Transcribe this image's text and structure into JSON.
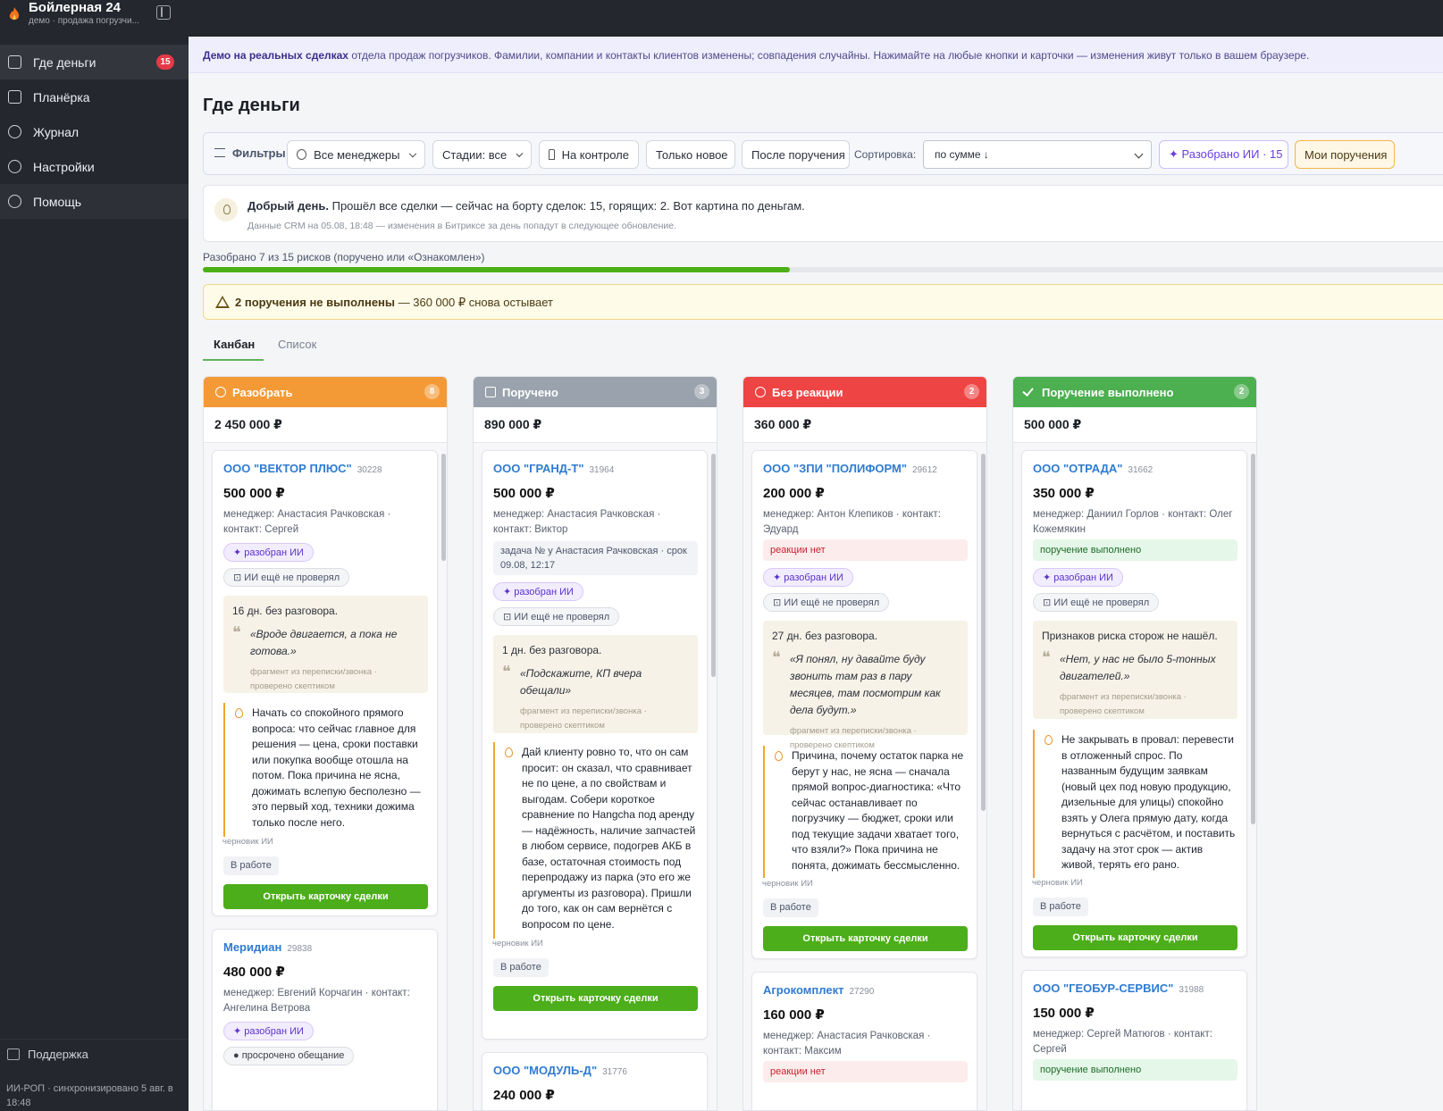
{
  "app": {
    "title": "Бойлерная 24",
    "subtitle": "демо · продажа погрузчи...",
    "sync_text": "ИИ-РОП · синхронизировано 5 авг. в 18:48"
  },
  "sidebar": {
    "items": [
      {
        "label": "Где деньги",
        "icon": "wallet-icon",
        "badge": "15"
      },
      {
        "label": "Планёрка",
        "icon": "clipboard-icon"
      },
      {
        "label": "Журнал",
        "icon": "history-icon"
      },
      {
        "label": "Настройки",
        "icon": "gear-icon"
      },
      {
        "label": "Помощь",
        "icon": "help-icon"
      }
    ],
    "support_label": "Поддержка"
  },
  "banner": {
    "bold": "Демо на реальных сделках",
    "text": " отдела продаж погрузчиков. Фамилии, компании и контакты клиентов изменены; совпадения случайны. Нажимайте на любые кнопки и карточки — изменения живут только в вашем браузере."
  },
  "page_title": "Где деньги",
  "filters": {
    "label": "Фильтры",
    "managers": "Все менеджеры",
    "stages": "Стадии: все",
    "on_control": "На контроле",
    "only_new": "Только новое",
    "after_task": "После поручения",
    "sort_label": "Сортировка:",
    "sort_value": "по сумме ↓",
    "ai_sorted": "✦ Разобрано ИИ · 15",
    "my_tasks": "Мои поручения"
  },
  "greeting": {
    "bold": "Добрый день.",
    "text": " Прошёл все сделки — сейчас на борту сделок: 15, горящих: 2. Вот картина по деньгам.",
    "sub": "Данные CRM на 05.08, 18:48 — изменения в Битриксе за день попадут в следующее обновление."
  },
  "progress": {
    "label": "Разобрано 7 из 15 рисков (поручено или «Ознакомлен»)",
    "fraction": 0.469
  },
  "alert": {
    "bold": "2 поручения не выполнены",
    "text": " — 360 000 ₽ снова остывает"
  },
  "tabs": [
    "Канбан",
    "Список"
  ],
  "columns": [
    {
      "title": "Разобрать",
      "count": "8",
      "total": "2 450 000 ₽",
      "color": "#f39a37",
      "icon": "flame-icon",
      "cards": [
        {
          "company": "ООО \"ВЕКТОР ПЛЮС\"",
          "id": "30228",
          "amount": "500 000 ₽",
          "meta": "менеджер: Анастасия Рачковская · контакт: Сергей",
          "tags": [
            "✦ разобран ИИ",
            "ИИ ещё не проверял"
          ],
          "quote_head": "16 дн. без разговора.",
          "quote": "«Вроде двигается, а пока не готова.»",
          "quote_src": "фрагмент из переписки/звонка · проверено скептиком",
          "advice": "Начать со спокойного прямого вопроса: что сейчас главное для решения — цена, сроки поставки или покупка вообще отошла на потом. Пока причина не ясна, дожимать вслепую бесполезно — это первый ход, техники дожима только после него.",
          "draft": "черновик ИИ",
          "state": "В работе",
          "open": "Открыть карточку сделки"
        },
        {
          "company": "Меридиан",
          "id": "29838",
          "amount": "480 000 ₽",
          "meta": "менеджер: Евгений Корчагин · контакт: Ангелина Ветрова",
          "tags": [
            "✦ разобран ИИ",
            "● просрочено обещание"
          ]
        }
      ]
    },
    {
      "title": "Поручено",
      "count": "3",
      "total": "890 000 ₽",
      "color": "#9aa3ad",
      "icon": "pause-icon",
      "cards": [
        {
          "company": "ООО \"ГРАНД-Т\"",
          "id": "31964",
          "amount": "500 000 ₽",
          "meta": "менеджер: Анастасия Рачковская · контакт: Виктор",
          "status": "задача № у Анастасия Рачковская · срок 09.08, 12:17",
          "tags": [
            "✦ разобран ИИ",
            "ИИ ещё не проверял"
          ],
          "quote_head": "1 дн. без разговора.",
          "quote": "«Подскажите, КП вчера обещали»",
          "quote_src": "фрагмент из переписки/звонка · проверено скептиком",
          "advice": "Дай клиенту ровно то, что он сам просит: он сказал, что сравнивает не по цене, а по свойствам и выгодам. Собери короткое сравнение по Hangcha под аренду — надёжность, наличие запчастей в любом сервисе, подогрев АКБ в базе, остаточная стоимость под перепродажу из парка (это его же аргументы из разговора). Пришли до того, как он сам вернётся с вопросом по цене.",
          "draft": "черновик ИИ",
          "state": "В работе",
          "open": "Открыть карточку сделки"
        },
        {
          "company": "ООО \"МОДУЛЬ-Д\"",
          "id": "31776",
          "amount": "240 000 ₽"
        }
      ]
    },
    {
      "title": "Без реакции",
      "count": "2",
      "total": "360 000 ₽",
      "color": "#ef4444",
      "icon": "question-icon",
      "cards": [
        {
          "company": "ООО \"ЗПИ \"ПОЛИФОРМ\"",
          "id": "29612",
          "amount": "200 000 ₽",
          "meta": "менеджер: Антон Клепиков · контакт: Эдуард",
          "status": "реакции нет",
          "tags": [
            "✦ разобран ИИ",
            "ИИ ещё не проверял"
          ],
          "quote_head": "27 дн. без разговора.",
          "quote": "«Я понял, ну давайте буду звонить там раз в пару месяцев, там посмотрим как дела будут.»",
          "quote_src": "фрагмент из переписки/звонка · проверено скептиком",
          "advice": "Причина, почему остаток парка не берут у нас, не ясна — сначала прямой вопрос-диагностика: «Что сейчас останавливает по погрузчику — бюджет, сроки или под текущие задачи хватает того, что взяли?» Пока причина не понята, дожимать бессмысленно.",
          "draft": "черновик ИИ",
          "state": "В работе",
          "open": "Открыть карточку сделки"
        },
        {
          "company": "Агрокомплект",
          "id": "27290",
          "amount": "160 000 ₽",
          "meta": "менеджер: Анастасия Рачковская · контакт: Максим",
          "status": "реакции нет"
        }
      ]
    },
    {
      "title": "Поручение выполнено",
      "count": "2",
      "total": "500 000 ₽",
      "color": "#4caf50",
      "icon": "check-icon",
      "cards": [
        {
          "company": "ООО \"ОТРАДА\"",
          "id": "31662",
          "amount": "350 000 ₽",
          "meta": "менеджер: Даниил Горлов · контакт: Олег Кожемякин",
          "status": "поручение выполнено",
          "tags": [
            "✦ разобран ИИ",
            "ИИ ещё не проверял"
          ],
          "quote_head": "Признаков риска сторож не нашёл.",
          "quote": "«Нет, у нас не было 5-тонных двигателей.»",
          "quote_src": "фрагмент из переписки/звонка · проверено скептиком",
          "advice": "Не закрывать в провал: перевести в отложенный спрос. По названным будущим заявкам (новый цех под новую продукцию, дизельные для улицы) спокойно взять у Олега прямую дату, когда вернуться с расчётом, и поставить задачу на этот срок — актив живой, терять его рано.",
          "draft": "черновик ИИ",
          "state": "В работе",
          "open": "Открыть карточку сделки"
        },
        {
          "company": "ООО \"ГЕОБУР-СЕРВИС\"",
          "id": "31988",
          "amount": "150 000 ₽",
          "meta": "менеджер: Сергей Матюгов · контакт: Сергей",
          "status": "поручение выполнено"
        }
      ]
    }
  ]
}
